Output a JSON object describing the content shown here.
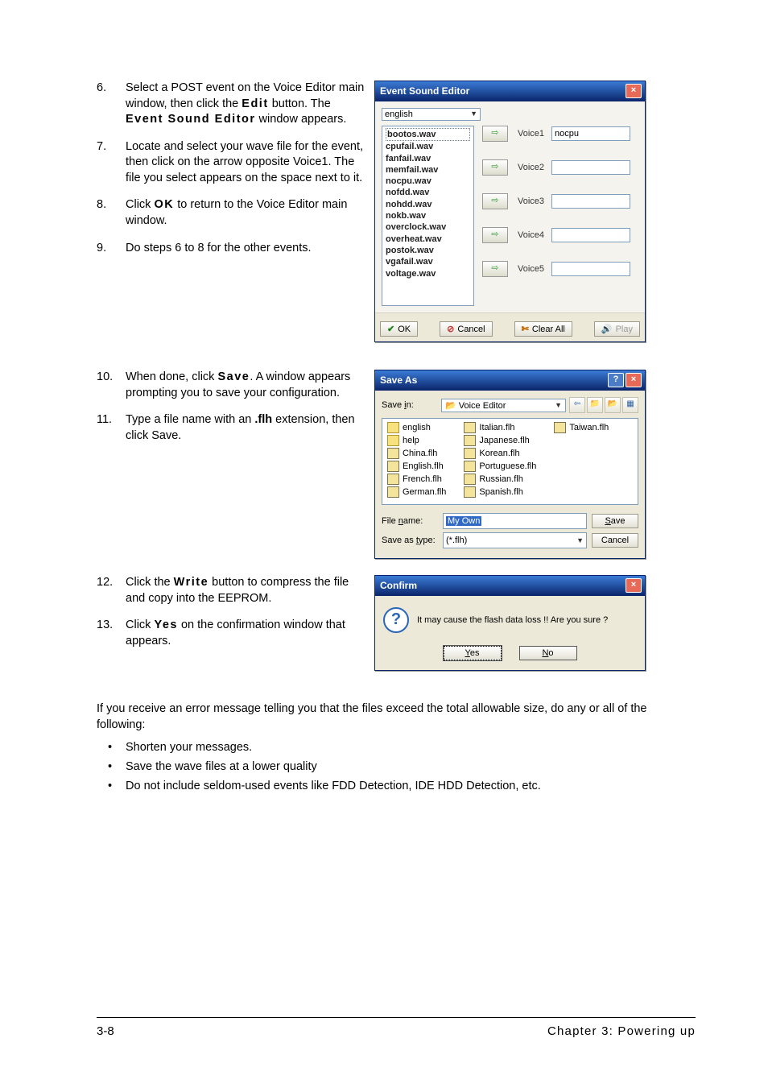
{
  "steps_a": [
    {
      "n": "6.",
      "html": "Select a POST event on the Voice Editor main window, then click the <span class='spaced'>Edit</span> button. The <span class='spaced'>Event Sound Editor</span> window appears."
    },
    {
      "n": "7.",
      "html": "Locate and select your wave file for the event, then click on the arrow opposite Voice1. The file you select appears on the space next to it."
    },
    {
      "n": "8.",
      "html": "Click <span class='spaced'>OK</span> to return to the Voice Editor main window."
    },
    {
      "n": "9.",
      "html": "Do steps 6 to 8 for the other events."
    }
  ],
  "steps_b": [
    {
      "n": "10.",
      "html": "When done, click <span class='spaced'>Save</span>. A window appears prompting you to save your configuration."
    },
    {
      "n": "11.",
      "html": "Type a file name with an <span class='bold'>.flh</span> extension, then click Save."
    }
  ],
  "steps_c": [
    {
      "n": "12.",
      "html": "Click the <span class='spaced'>Write</span> button to compress the file and copy into the EEPROM."
    },
    {
      "n": "13.",
      "html": "Click <span class='spaced'>Yes</span> on the confirmation window that appears."
    }
  ],
  "after_para": "If you receive an error message telling you that the files exceed the total allowable size, do any or all of the following:",
  "bullets": [
    "Shorten your messages.",
    "Save the wave files at a lower quality",
    "Do not include seldom-used events like FDD Detection, IDE HDD Detection, etc."
  ],
  "ese": {
    "title": "Event Sound Editor",
    "dd": "english",
    "files": [
      "bootos.wav",
      "cpufail.wav",
      "fanfail.wav",
      "memfail.wav",
      "nocpu.wav",
      "nofdd.wav",
      "nohdd.wav",
      "nokb.wav",
      "overclock.wav",
      "overheat.wav",
      "postok.wav",
      "vgafail.wav",
      "voltage.wav"
    ],
    "selected_file_index": 0,
    "voices": [
      {
        "label": "Voice1",
        "value": "nocpu"
      },
      {
        "label": "Voice2",
        "value": ""
      },
      {
        "label": "Voice3",
        "value": ""
      },
      {
        "label": "Voice4",
        "value": ""
      },
      {
        "label": "Voice5",
        "value": ""
      }
    ],
    "buttons": {
      "ok": "OK",
      "cancel": "Cancel",
      "clear": "Clear All",
      "play": "Play"
    }
  },
  "saveas": {
    "title": "Save As",
    "save_in_lbl": "Save in:",
    "save_in_val": "Voice Editor",
    "cols": [
      [
        {
          "t": "english",
          "d": true
        },
        {
          "t": "help",
          "d": true
        },
        {
          "t": "China.flh"
        },
        {
          "t": "English.flh"
        },
        {
          "t": "French.flh"
        },
        {
          "t": "German.flh"
        }
      ],
      [
        {
          "t": "Italian.flh"
        },
        {
          "t": "Japanese.flh"
        },
        {
          "t": "Korean.flh"
        },
        {
          "t": "Portuguese.flh"
        },
        {
          "t": "Russian.flh"
        },
        {
          "t": "Spanish.flh"
        }
      ],
      [
        {
          "t": "Taiwan.flh"
        }
      ]
    ],
    "file_name_lbl": "File name:",
    "file_name_val": "My Own",
    "type_lbl": "Save as type:",
    "type_val": "(*.flh)",
    "save_btn": "Save",
    "cancel_btn": "Cancel"
  },
  "confirm": {
    "title": "Confirm",
    "msg": "It may cause the flash data loss !!  Are you sure ?",
    "yes": "Yes",
    "no": "No"
  },
  "footer": {
    "left": "3-8",
    "right_pre": "Chapter 3: ",
    "right_post": "Powering up"
  }
}
